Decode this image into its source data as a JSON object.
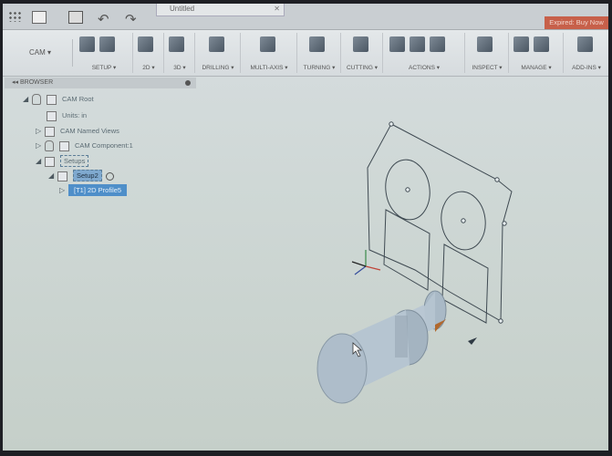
{
  "title_bar": {
    "document_tab": "Untitled",
    "expired_button": "Expired: Buy Now"
  },
  "ribbon": {
    "workspace": "CAM ▾",
    "groups": [
      {
        "label": "SETUP ▾"
      },
      {
        "label": "2D ▾"
      },
      {
        "label": "3D ▾"
      },
      {
        "label": "DRILLING ▾"
      },
      {
        "label": "MULTI-AXIS ▾"
      },
      {
        "label": "TURNING ▾"
      },
      {
        "label": "CUTTING ▾"
      },
      {
        "label": "ACTIONS ▾"
      },
      {
        "label": "INSPECT ▾"
      },
      {
        "label": "MANAGE ▾"
      },
      {
        "label": "ADD-INS ▾"
      }
    ]
  },
  "browser": {
    "header": "BROWSER",
    "items": [
      {
        "label": "CAM Root"
      },
      {
        "label": "Units: in"
      },
      {
        "label": "CAM Named Views"
      },
      {
        "label": "CAM Component:1"
      },
      {
        "label": "Setups"
      },
      {
        "label": "Setup2"
      },
      {
        "label": "[T1] 2D Profile5"
      }
    ]
  }
}
